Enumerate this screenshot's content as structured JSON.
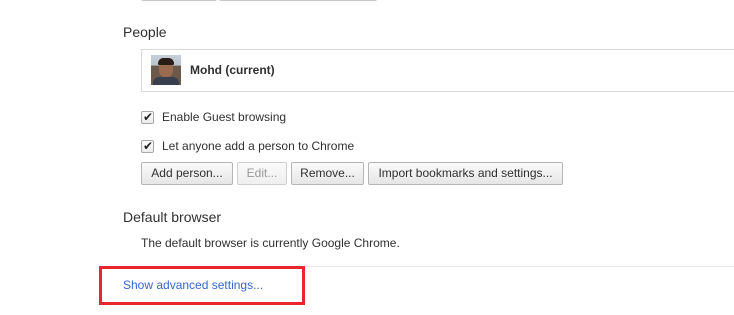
{
  "people": {
    "title": "People",
    "profiles": [
      {
        "name": "Mohd (current)"
      }
    ],
    "options": [
      {
        "label": "Enable Guest browsing",
        "checked": true
      },
      {
        "label": "Let anyone add a person to Chrome",
        "checked": true
      }
    ],
    "buttons": {
      "add_person": "Add person...",
      "edit": "Edit...",
      "remove": "Remove...",
      "import": "Import bookmarks and settings..."
    }
  },
  "default_browser": {
    "title": "Default browser",
    "description": "The default browser is currently Google Chrome."
  },
  "advanced_link": "Show advanced settings...",
  "colors": {
    "link": "#3366cc",
    "highlight": "#e8262b"
  }
}
